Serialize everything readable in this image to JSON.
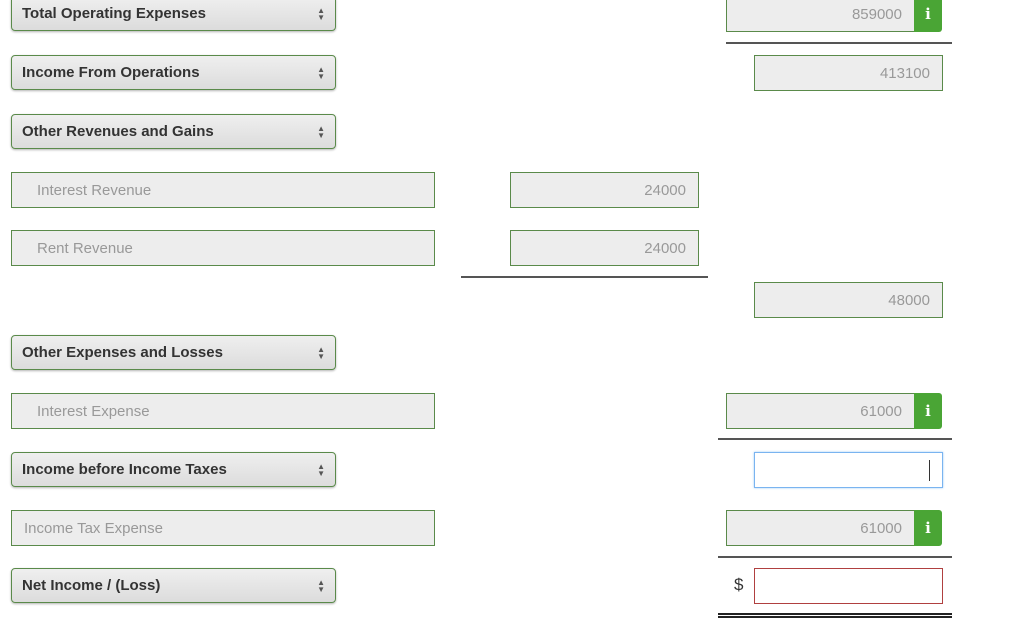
{
  "rows": {
    "total_operating_expenses": {
      "label": "Total Operating Expenses",
      "value": "859000"
    },
    "income_from_operations": {
      "label": "Income From Operations",
      "value": "413100"
    },
    "other_revenues": {
      "label": "Other Revenues and Gains"
    },
    "interest_revenue": {
      "label": "Interest Revenue",
      "value": "24000"
    },
    "rent_revenue": {
      "label": "Rent Revenue",
      "value": "24000"
    },
    "other_revenues_total": {
      "value": "48000"
    },
    "other_expenses": {
      "label": "Other Expenses and Losses"
    },
    "interest_expense": {
      "label": "Interest Expense",
      "value": "61000"
    },
    "income_before_taxes": {
      "label": "Income before Income Taxes",
      "value": ""
    },
    "income_tax_expense": {
      "label": "Income Tax Expense",
      "value": "61000"
    },
    "net_income": {
      "label": "Net Income / (Loss)",
      "currency": "$",
      "value": ""
    }
  },
  "info_label": "i",
  "colors": {
    "border": "#5a8a4a",
    "info": "#4aa535",
    "focus": "#7ab4f0",
    "error": "#b04040"
  }
}
